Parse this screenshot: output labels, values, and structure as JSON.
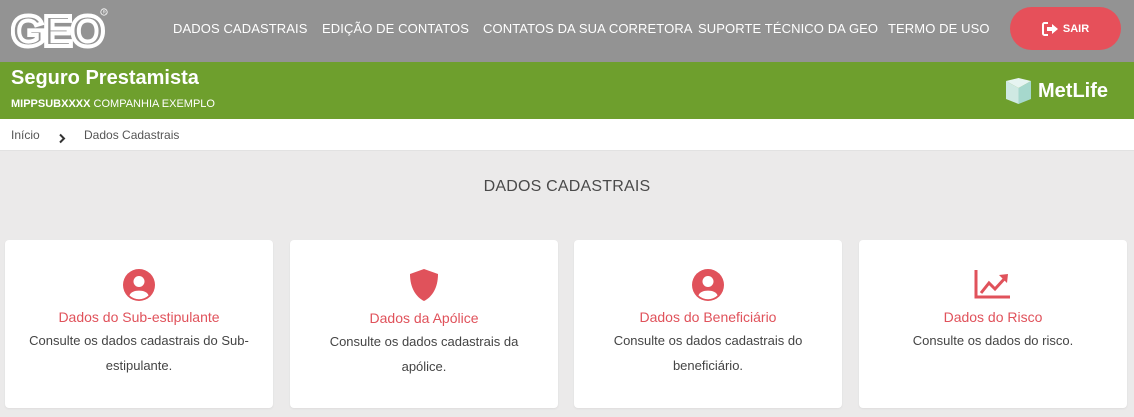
{
  "header": {
    "logo_text": "GEO",
    "nav_items": [
      "DADOS CADASTRAIS",
      "EDIÇÃO DE CONTATOS",
      "CONTATOS DA SUA CORRETORA",
      "SUPORTE TÉCNICO DA GEO",
      "TERMO DE USO"
    ],
    "logout_label": "SAIR",
    "logout_icon": "logout-icon",
    "logout_color": "#e6505a",
    "bg_color": "#939393"
  },
  "product_bar": {
    "title": "Seguro Prestamista",
    "code": "MIPPSUBXXXX",
    "company": "COMPANHIA EXEMPLO",
    "brand": "MetLife",
    "bg_color": "#6e9f2d"
  },
  "breadcrumb": {
    "items": [
      "Início",
      "Dados Cadastrais"
    ]
  },
  "page": {
    "title": "DADOS CADASTRAIS"
  },
  "cards": [
    {
      "icon": "user-circle-icon",
      "title": "Dados do Sub-estipulante",
      "description": "Consulte os dados cadastrais do Sub-estipulante."
    },
    {
      "icon": "shield-icon",
      "title": "Dados da Apólice",
      "description": "Consulte os dados cadastrais da apólice."
    },
    {
      "icon": "user-circle-icon",
      "title": "Dados do Beneficiário",
      "description": "Consulte os dados cadastrais do beneficiário."
    },
    {
      "icon": "trend-chart-icon",
      "title": "Dados do Risco",
      "description": "Consulte os dados do risco."
    }
  ],
  "accent_color": "#e0525b"
}
